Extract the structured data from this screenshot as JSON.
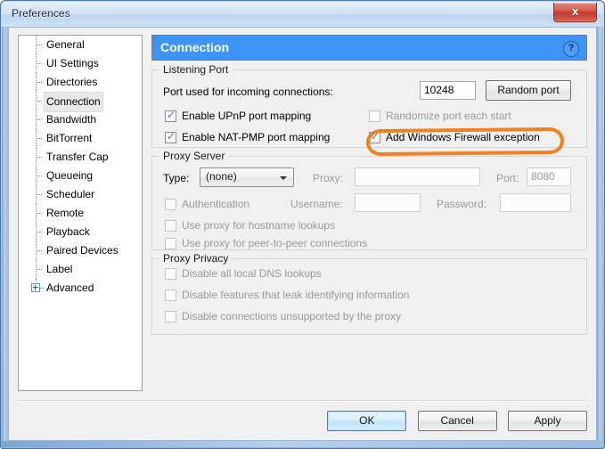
{
  "window": {
    "title": "Preferences",
    "close_label": "x",
    "close_icon": "close-icon"
  },
  "sidebar": {
    "items": [
      {
        "label": "General",
        "selected": false,
        "expandable": false
      },
      {
        "label": "UI Settings",
        "selected": false,
        "expandable": false
      },
      {
        "label": "Directories",
        "selected": false,
        "expandable": false
      },
      {
        "label": "Connection",
        "selected": true,
        "expandable": false
      },
      {
        "label": "Bandwidth",
        "selected": false,
        "expandable": false
      },
      {
        "label": "BitTorrent",
        "selected": false,
        "expandable": false
      },
      {
        "label": "Transfer Cap",
        "selected": false,
        "expandable": false
      },
      {
        "label": "Queueing",
        "selected": false,
        "expandable": false
      },
      {
        "label": "Scheduler",
        "selected": false,
        "expandable": false
      },
      {
        "label": "Remote",
        "selected": false,
        "expandable": false
      },
      {
        "label": "Playback",
        "selected": false,
        "expandable": false
      },
      {
        "label": "Paired Devices",
        "selected": false,
        "expandable": false
      },
      {
        "label": "Label",
        "selected": false,
        "expandable": false
      },
      {
        "label": "Advanced",
        "selected": false,
        "expandable": true
      }
    ]
  },
  "pane": {
    "header_title": "Connection",
    "help_label": "?",
    "header_color": "#3d94f6"
  },
  "listening_port": {
    "group_title": "Listening Port",
    "port_label": "Port used for incoming connections:",
    "port_value": "10248",
    "random_port_button": "Random port",
    "checkboxes": [
      {
        "label": "Enable UPnP port mapping",
        "checked": true,
        "disabled": false
      },
      {
        "label": "Enable NAT-PMP port mapping",
        "checked": true,
        "disabled": false
      },
      {
        "label": "Randomize port each start",
        "checked": false,
        "disabled": true
      },
      {
        "label": "Add Windows Firewall exception",
        "checked": true,
        "disabled": false
      }
    ]
  },
  "proxy_server": {
    "group_title": "Proxy Server",
    "type_label": "Type:",
    "type_value": "(none)",
    "proxy_label": "Proxy:",
    "proxy_value": "",
    "port_label": "Port:",
    "port_value": "8080",
    "username_label": "Username:",
    "username_value": "",
    "password_label": "Password:",
    "password_value": "",
    "checkboxes": [
      {
        "label": "Authentication",
        "checked": false,
        "disabled": true
      },
      {
        "label": "Use proxy for hostname lookups",
        "checked": false,
        "disabled": true
      },
      {
        "label": "Use proxy for peer-to-peer connections",
        "checked": false,
        "disabled": true
      }
    ]
  },
  "proxy_privacy": {
    "group_title": "Proxy Privacy",
    "checkboxes": [
      {
        "label": "Disable all local DNS lookups",
        "checked": false,
        "disabled": true
      },
      {
        "label": "Disable features that leak identifying information",
        "checked": false,
        "disabled": true
      },
      {
        "label": "Disable connections unsupported by the proxy",
        "checked": false,
        "disabled": true
      }
    ]
  },
  "footer": {
    "ok": "OK",
    "cancel": "Cancel",
    "apply": "Apply"
  },
  "annotation": {
    "color": "#f08020",
    "target": "Add Windows Firewall exception"
  }
}
